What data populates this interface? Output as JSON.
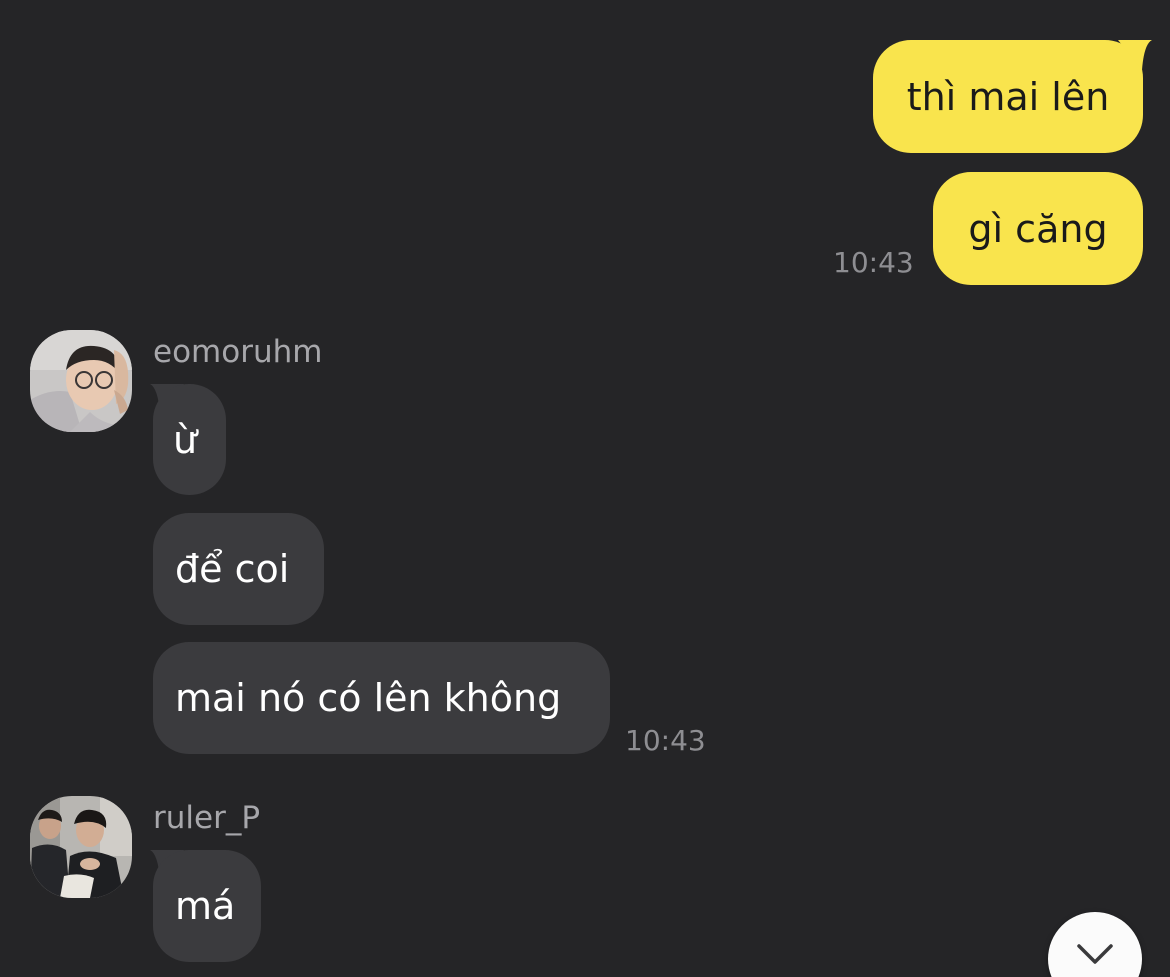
{
  "messages": {
    "outgoing": [
      {
        "text": "thì mai lên"
      },
      {
        "text": "gì căng",
        "time": "10:43"
      }
    ],
    "group1": {
      "sender": "eomoruhm",
      "bubbles": [
        "ừ",
        "để coi",
        "mai nó có lên không"
      ],
      "time": "10:43"
    },
    "group2": {
      "sender": "ruler_P",
      "bubbles": [
        "má"
      ]
    }
  },
  "colors": {
    "background": "#252527",
    "outgoing_bubble": "#f9e44d",
    "incoming_bubble": "#3b3b3e"
  },
  "icons": {
    "scroll_down": "chevron-down-icon"
  }
}
